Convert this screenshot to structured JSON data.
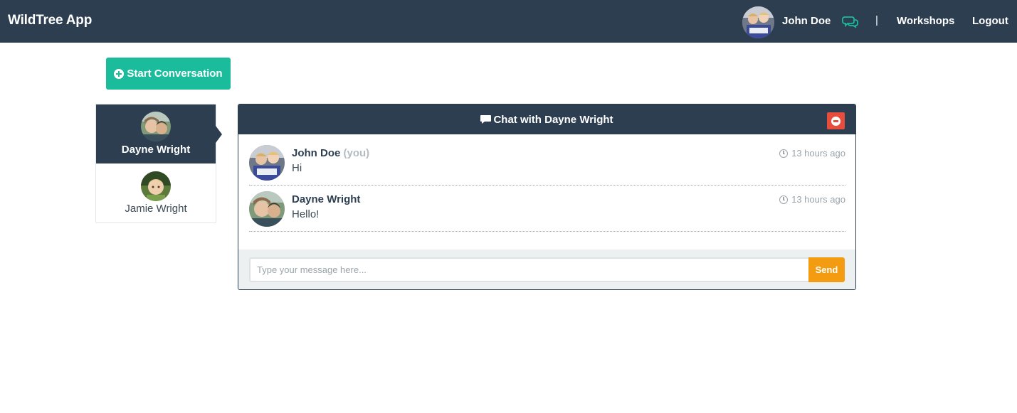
{
  "navbar": {
    "brand": "WildTree App",
    "user_name": "John Doe",
    "separator": "|",
    "workshops_label": "Workshops",
    "logout_label": "Logout",
    "chat_icon_color": "#1abc9c"
  },
  "toolbar": {
    "start_conversation_label": "Start Conversation"
  },
  "contacts": [
    {
      "name": "Dayne Wright",
      "active": true
    },
    {
      "name": "Jamie Wright",
      "active": false
    }
  ],
  "chat": {
    "title": "Chat with Dayne Wright",
    "messages": [
      {
        "sender": "John Doe",
        "you_tag": "(you)",
        "text": "Hi",
        "time": "13 hours ago"
      },
      {
        "sender": "Dayne Wright",
        "you_tag": "",
        "text": "Hello!",
        "time": "13 hours ago"
      }
    ],
    "input_placeholder": "Type your message here...",
    "input_value": "",
    "send_label": "Send"
  },
  "colors": {
    "navbar": "#2c3e50",
    "primary": "#1abc9c",
    "danger": "#e74c3c",
    "warning": "#f39c12"
  }
}
